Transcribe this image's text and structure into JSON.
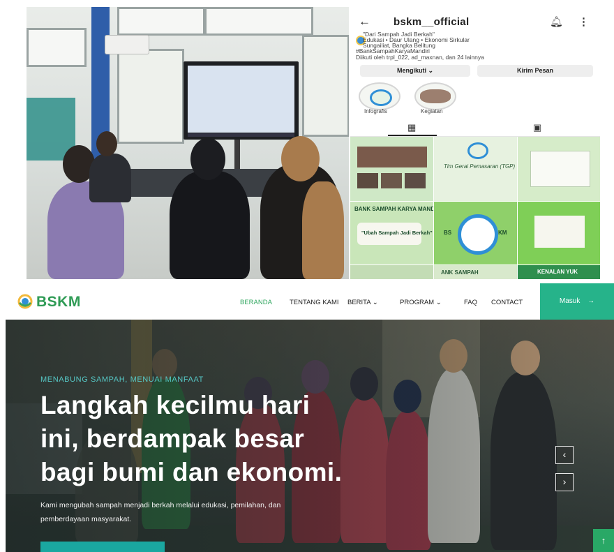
{
  "instagram": {
    "back_icon": "arrow-left-icon",
    "username": "bskm__official",
    "bell_icon": "bell-icon",
    "more_icon": "more-vertical-icon",
    "bio": [
      "\"Dari Sampah Jadi Berkah\"",
      "Edukasi • Daur Ulang • Ekonomi Sirkular",
      "Sungailiat, Bangka Belitung",
      "#BankSampahKaryaMandiri"
    ],
    "followed_by": "Diikuti oleh trpl_022, ad_maxnan, dan 24 lainnya",
    "follow_button": "Mengikuti",
    "message_button": "Kirim Pesan",
    "highlights": [
      "Infografis",
      "Kegiatan"
    ],
    "tiles": {
      "t5": "Tim Gerai Pemasaran (TGP)",
      "t7": "BANK SAMPAH KARYA MANDIRI",
      "t7b": "\"Ubah Sampah Jadi Berkah\"",
      "t8a": "BS",
      "t8b": "KM",
      "t11": "ANK SAMPAH",
      "t12": "KENALAN YUK"
    }
  },
  "site": {
    "brand": "BSKM",
    "nav": [
      "BERANDA",
      "TENTANG KAMI",
      "BERITA",
      "PROGRAM",
      "FAQ",
      "CONTACT"
    ],
    "login": "Masuk",
    "hero": {
      "kicker": "MENABUNG SAMPAH, MENUAI MANFAAT",
      "title_lines": [
        "Langkah kecilmu hari",
        "ini, berdampak besar",
        "bagi bumi dan ekonomi."
      ],
      "subtitle_lines": [
        "Kami mengubah sampah menjadi berkah melalui edukasi, pemilahan, dan",
        "pemberdayaan masyarakat."
      ],
      "prev": "‹",
      "next": "›",
      "top": "↑"
    }
  },
  "colors": {
    "brand_green": "#2f9b55",
    "accent_teal": "#26b38a",
    "kicker_teal": "#56c7c5",
    "nav_active": "#2fa65e"
  }
}
